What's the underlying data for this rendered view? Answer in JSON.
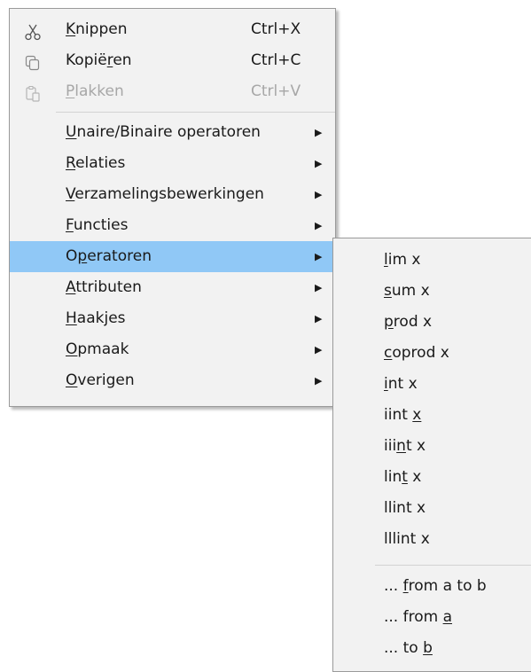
{
  "main_menu": {
    "clipboard": [
      {
        "icon": "scissors-icon",
        "pre": "",
        "acc": "K",
        "post": "nippen",
        "shortcut": "Ctrl+X",
        "enabled": true
      },
      {
        "icon": "copy-icon",
        "pre": "Kopië",
        "acc": "r",
        "post": "en",
        "shortcut": "Ctrl+C",
        "enabled": true
      },
      {
        "icon": "paste-icon",
        "pre": "",
        "acc": "P",
        "post": "lakken",
        "shortcut": "Ctrl+V",
        "enabled": false
      }
    ],
    "categories": [
      {
        "pre": "",
        "acc": "U",
        "post": "naire/Binaire operatoren",
        "highlighted": false
      },
      {
        "pre": "",
        "acc": "R",
        "post": "elaties",
        "highlighted": false
      },
      {
        "pre": "",
        "acc": "V",
        "post": "erzamelingsbewerkingen",
        "highlighted": false
      },
      {
        "pre": "",
        "acc": "F",
        "post": "uncties",
        "highlighted": false
      },
      {
        "pre": "O",
        "acc": "p",
        "post": "eratoren",
        "highlighted": true
      },
      {
        "pre": "",
        "acc": "A",
        "post": "ttributen",
        "highlighted": false
      },
      {
        "pre": "",
        "acc": "H",
        "post": "aakjes",
        "highlighted": false
      },
      {
        "pre": "",
        "acc": "O",
        "post": "pmaak",
        "highlighted": false
      },
      {
        "pre": "",
        "acc": "O",
        "post": "verigen",
        "highlighted": false
      }
    ],
    "submenu_arrow": "▶"
  },
  "operators_submenu": {
    "items": [
      {
        "pre": "",
        "acc": "l",
        "post": "im x"
      },
      {
        "pre": "",
        "acc": "s",
        "post": "um x"
      },
      {
        "pre": "",
        "acc": "p",
        "post": "rod x"
      },
      {
        "pre": "",
        "acc": "c",
        "post": "oprod x"
      },
      {
        "pre": "",
        "acc": "i",
        "post": "nt x"
      },
      {
        "pre": "iint ",
        "acc": "x",
        "post": ""
      },
      {
        "pre": "iii",
        "acc": "n",
        "post": "t x"
      },
      {
        "pre": "lin",
        "acc": "t",
        "post": " x"
      },
      {
        "pre": "llint x",
        "acc": "",
        "post": ""
      },
      {
        "pre": "lllint x",
        "acc": "",
        "post": ""
      }
    ],
    "range_items": [
      {
        "pre": "... ",
        "acc": "f",
        "post": "rom a to b"
      },
      {
        "pre": "... from ",
        "acc": "a",
        "post": ""
      },
      {
        "pre": "... to ",
        "acc": "b",
        "post": ""
      }
    ]
  }
}
